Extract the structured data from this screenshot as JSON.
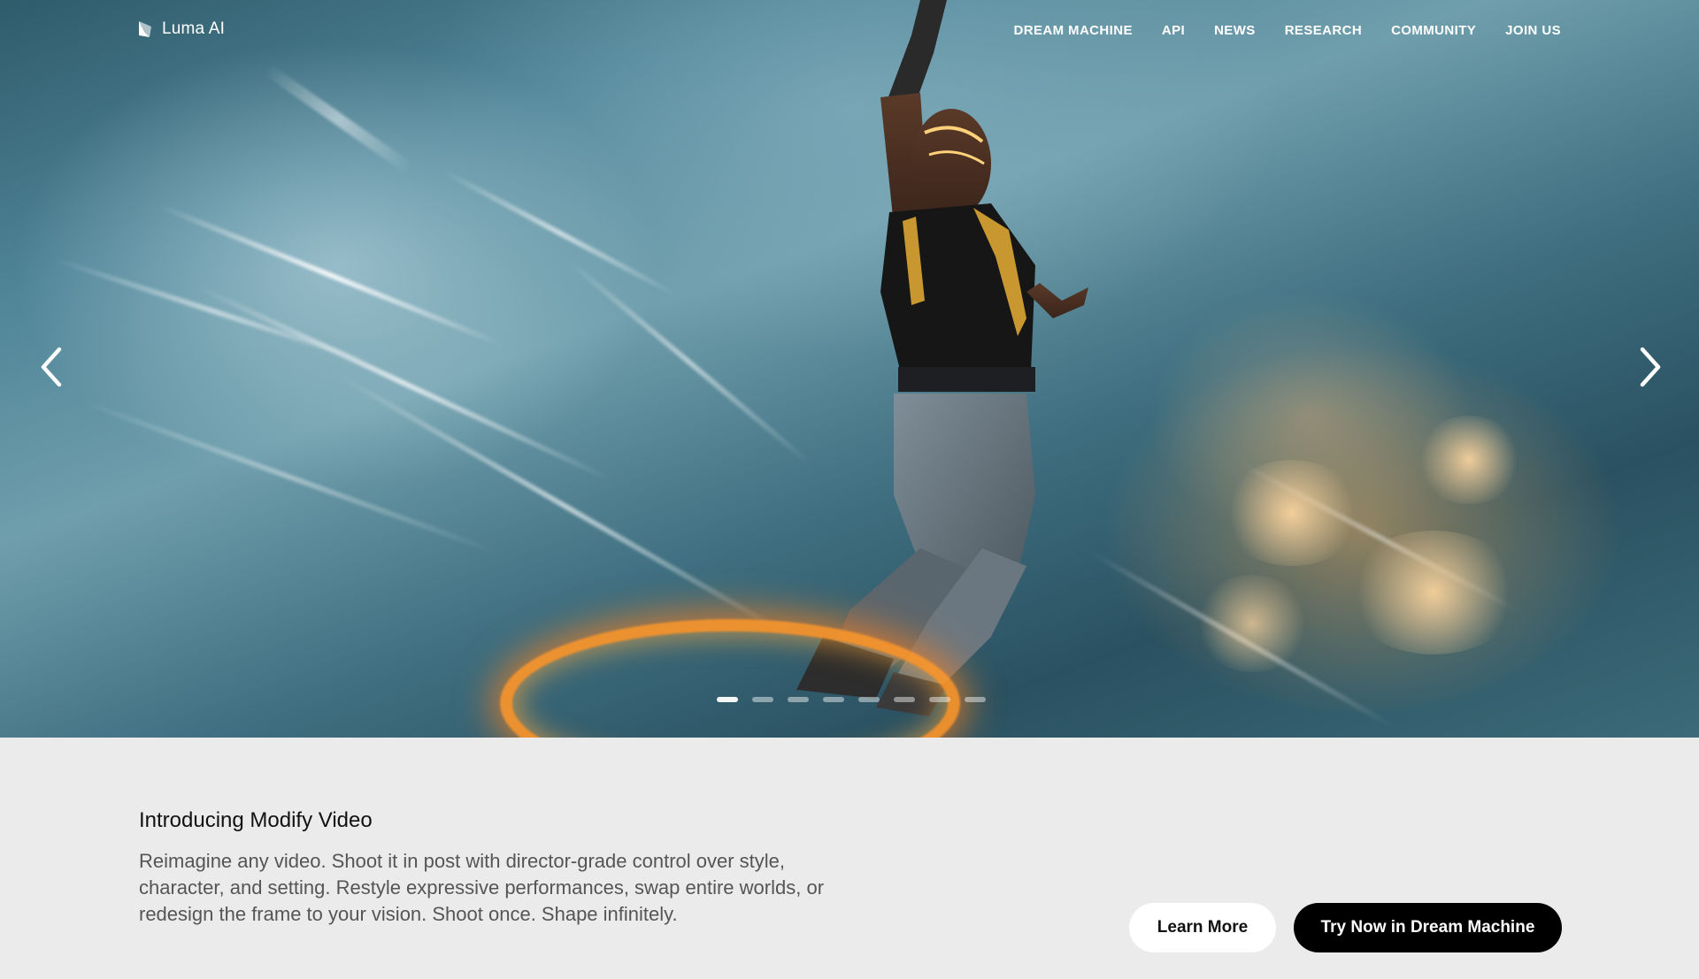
{
  "brand": {
    "name": "Luma AI",
    "icon": "luma-logo-icon"
  },
  "nav": {
    "items": [
      {
        "label": "DREAM MACHINE"
      },
      {
        "label": "API"
      },
      {
        "label": "NEWS"
      },
      {
        "label": "RESEARCH"
      },
      {
        "label": "COMMUNITY"
      },
      {
        "label": "JOIN US"
      }
    ]
  },
  "carousel": {
    "prev_icon": "chevron-left-icon",
    "next_icon": "chevron-right-icon",
    "slide_count": 8,
    "active_index": 0
  },
  "feature": {
    "title": "Introducing Modify Video",
    "description": "Reimagine any video. Shoot it in post with director-grade control over style, character, and setting. Restyle expressive performances, swap entire worlds, or redesign the frame to your vision. Shoot once. Shape infinitely."
  },
  "buttons": {
    "learn_more": "Learn More",
    "try_now": "Try Now in Dream Machine"
  },
  "colors": {
    "content_bg": "#ebebeb",
    "primary_button_bg": "#000000",
    "secondary_button_bg": "#ffffff"
  }
}
